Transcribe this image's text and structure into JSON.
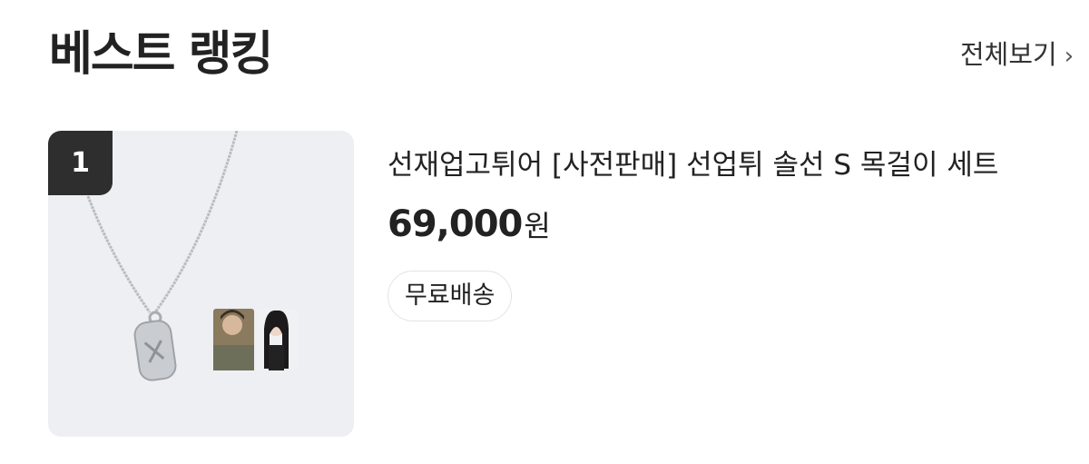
{
  "header": {
    "title": "베스트 랭킹",
    "view_all_label": "전체보기",
    "view_all_icon": "chevron-right-icon"
  },
  "products": [
    {
      "rank": "1",
      "name": "선재업고튀어 [사전판매] 선업튀 솔선 S 목걸이 세트",
      "price": "69,000",
      "currency": "원",
      "tag": "무료배송"
    }
  ],
  "colors": {
    "badge_bg": "#2e2e2e",
    "thumb_bg": "#eeeff2",
    "text": "#222222"
  }
}
